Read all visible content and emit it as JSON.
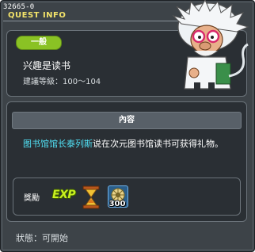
{
  "window": {
    "quest_id": "32665-0",
    "header_label": "QUEST INFO"
  },
  "quest": {
    "category_badge": "一般",
    "name": "兴趣是读书",
    "level_requirement": "建議等級：100～104"
  },
  "content": {
    "header": "內容",
    "npc_name": "图书馆馆长泰列斯",
    "description_rest": "说在次元图书馆读书可获得礼物。"
  },
  "rewards": {
    "label": "獎勵",
    "exp_label": "EXP",
    "items": [
      {
        "icon": "hourglass-item-icon",
        "quantity": ""
      },
      {
        "icon": "gear-coin-item-icon",
        "quantity": "300"
      }
    ]
  },
  "status": {
    "text": "狀態：可開始"
  },
  "colors": {
    "badge": "#8ac224",
    "npc_name": "#51e2f6",
    "header_label": "#f3e36a",
    "exp": "#c8f020"
  }
}
